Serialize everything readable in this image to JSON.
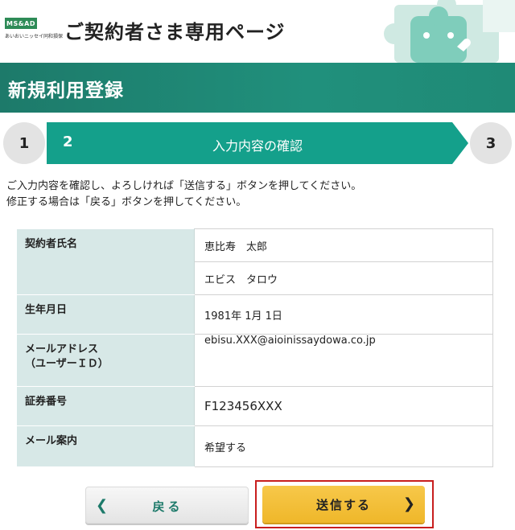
{
  "header": {
    "logo_text": "MS&AD",
    "logo_sub": "あいおいニッセイ同和損保",
    "site_title": "ご契約者さま専用ページ"
  },
  "band": {
    "title": "新規利用登録"
  },
  "steps": {
    "step1": "1",
    "step2": "2",
    "step2_label": "入力内容の確認",
    "step3": "3"
  },
  "instructions": {
    "line1": "ご入力内容を確認し、よろしければ「送信する」ボタンを押してください。",
    "line2": "修正する場合は「戻る」ボタンを押してください。"
  },
  "table": {
    "name_label": "契約者氏名",
    "name_kanji": "恵比寿　太郎",
    "name_kana": "エビス　タロウ",
    "birth_label": "生年月日",
    "birth_value": "1981年 1月 1日",
    "mail_label_1": "メールアドレス",
    "mail_label_2": "（ユーザーＩＤ）",
    "mail_value": "ebisu.XXX@aioinissaydowa.co.jp",
    "cert_label": "証券番号",
    "cert_value": "F123456XXX",
    "notice_label": "メール案内",
    "notice_value": "希望する"
  },
  "buttons": {
    "back_label": "戻る",
    "send_label": "送信する"
  },
  "colors": {
    "brand_green": "#1d7a6a",
    "step_active": "#14a08b",
    "send_yellow": "#f3c03a",
    "highlight_red": "#c81e1e"
  }
}
